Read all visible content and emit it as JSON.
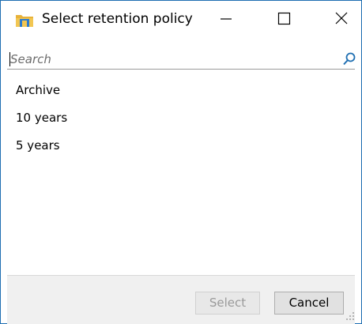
{
  "window": {
    "title": "Select retention policy",
    "icon": "folder-icon",
    "controls": [
      "minimize-icon",
      "maximize-icon",
      "close-icon"
    ]
  },
  "search": {
    "placeholder": "Search",
    "value": "",
    "icon": "search-icon"
  },
  "list": {
    "items": [
      {
        "label": "Archive"
      },
      {
        "label": "10 years"
      },
      {
        "label": "5 years"
      }
    ]
  },
  "footer": {
    "select_label": "Select",
    "cancel_label": "Cancel",
    "select_enabled": false
  },
  "colors": {
    "window_border": "#1f6fb2",
    "footer_bg": "#f0f0f0",
    "folder_yellow": "#e8b23a",
    "folder_blue": "#2d7ccf"
  }
}
